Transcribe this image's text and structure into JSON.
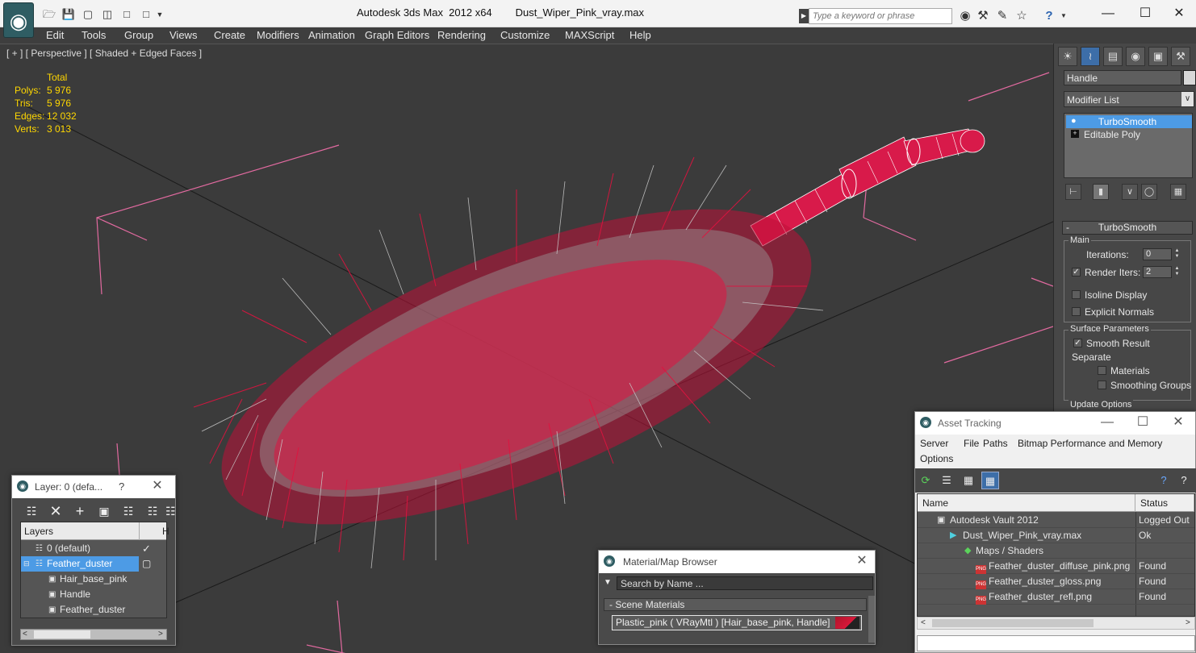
{
  "titlebar": {
    "app_title": "Autodesk 3ds Max  2012 x64",
    "file_name": "Dust_Wiper_Pink_vray.max",
    "search_placeholder": "Type a keyword or phrase",
    "help_icon": "question-icon"
  },
  "menu": [
    "Edit",
    "Tools",
    "Group",
    "Views",
    "Create",
    "Modifiers",
    "Animation",
    "Graph Editors",
    "Rendering",
    "Customize",
    "MAXScript",
    "Help"
  ],
  "viewport": {
    "label": "[ + ] [ Perspective ] [ Shaded + Edged Faces ]",
    "stats_header": "Total",
    "stats": [
      {
        "label": "Polys:",
        "value": "5 976"
      },
      {
        "label": "Tris:",
        "value": "5 976"
      },
      {
        "label": "Edges:",
        "value": "12 032"
      },
      {
        "label": "Verts:",
        "value": "3 013"
      }
    ],
    "fur_color": "#e0133f",
    "hair_color": "#b5b5b5"
  },
  "command_panel": {
    "object_name": "Handle",
    "modifier_list": "Modifier List",
    "stack": [
      "TurboSmooth",
      "Editable Poly"
    ],
    "rollout_title": "TurboSmooth",
    "main_group": "Main",
    "iterations_label": "Iterations:",
    "iterations_value": "0",
    "render_iters_label": "Render Iters:",
    "render_iters_value": "2",
    "isoline_label": "Isoline Display",
    "explicit_normals_label": "Explicit Normals",
    "surface_group": "Surface Parameters",
    "smooth_result_label": "Smooth Result",
    "separate_label": "Separate",
    "materials_label": "Materials",
    "smoothing_groups_label": "Smoothing Groups",
    "update_options_label": "Update Options"
  },
  "layer_dialog": {
    "title": "Layer: 0 (defa...",
    "help": "?",
    "column_header": "Layers",
    "column_header_2": "H",
    "rows": [
      {
        "name": "0 (default)"
      },
      {
        "name": "Feather_duster"
      },
      {
        "name": "Hair_base_pink"
      },
      {
        "name": "Handle"
      },
      {
        "name": "Feather_duster"
      }
    ]
  },
  "material_browser": {
    "title": "Material/Map Browser",
    "search_placeholder": "Search by Name ...",
    "group": "- Scene Materials",
    "item": "Plastic_pink  ( VRayMtl )  [Hair_base_pink, Handle]"
  },
  "asset_tracking": {
    "title": "Asset Tracking",
    "menu": [
      "Server",
      "File",
      "Paths",
      "Bitmap Performance and Memory",
      "Options"
    ],
    "col_name": "Name",
    "col_status": "Status",
    "rows": [
      {
        "name": "Autodesk Vault 2012",
        "status": "Logged Out"
      },
      {
        "name": "Dust_Wiper_Pink_vray.max",
        "status": "Ok"
      },
      {
        "name": "Maps / Shaders",
        "status": ""
      },
      {
        "name": "Feather_duster_diffuse_pink.png",
        "status": "Found"
      },
      {
        "name": "Feather_duster_gloss.png",
        "status": "Found"
      },
      {
        "name": "Feather_duster_refl.png",
        "status": "Found"
      }
    ]
  }
}
